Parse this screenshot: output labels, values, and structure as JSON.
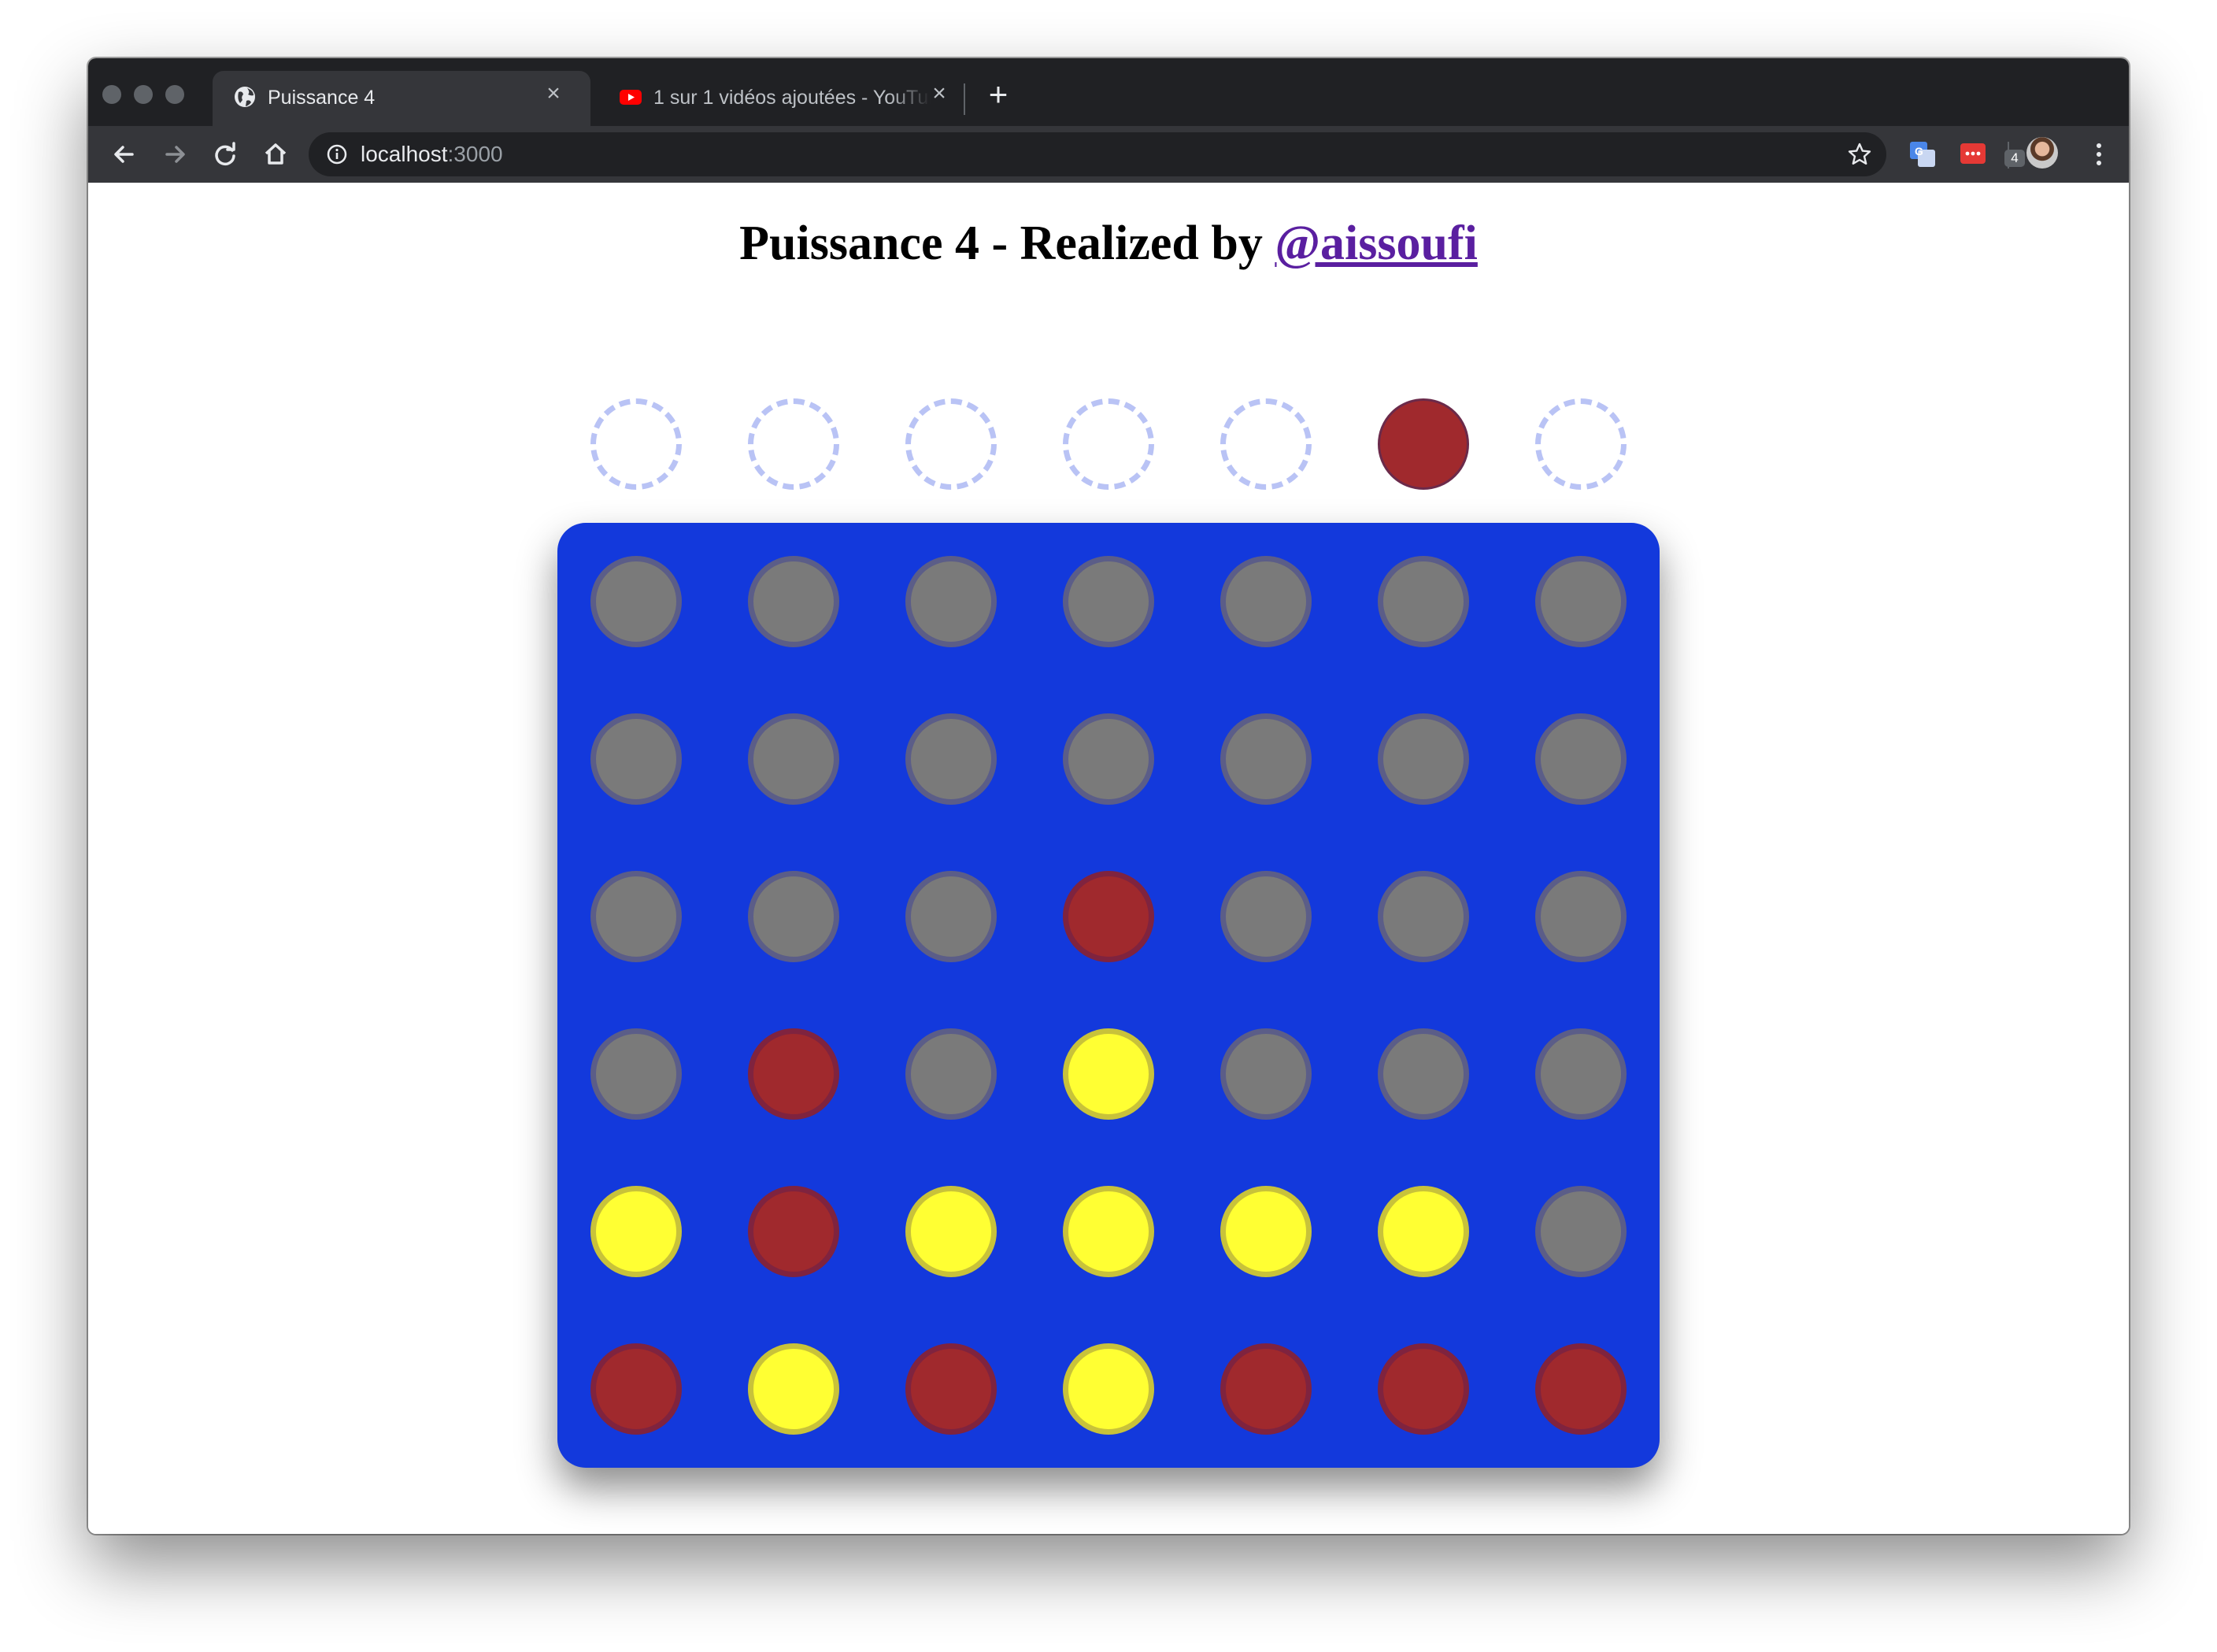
{
  "browser": {
    "tabs": [
      {
        "title": "Puissance 4",
        "active": true,
        "icon": "globe-icon"
      },
      {
        "title": "1 sur 1 vidéos ajoutées - YouTube",
        "active": false,
        "icon": "youtube-icon"
      }
    ],
    "address": {
      "host": "localhost",
      "port": ":3000"
    },
    "extensions_badge": "4"
  },
  "page": {
    "title_prefix": "Puissance 4 - Realized by ",
    "author_link": "@aissoufi"
  },
  "game": {
    "columns": 7,
    "rows": 6,
    "hover_column_index": 5,
    "current_player_color": "red",
    "colors": {
      "board": "#1339dc",
      "red": "#a0292d",
      "yellow": "#ffff33",
      "empty": "#7a7a7a",
      "selector_dashed": "#b9c3f5"
    },
    "grid": [
      [
        "empty",
        "empty",
        "empty",
        "empty",
        "empty",
        "empty",
        "empty"
      ],
      [
        "empty",
        "empty",
        "empty",
        "empty",
        "empty",
        "empty",
        "empty"
      ],
      [
        "empty",
        "empty",
        "empty",
        "red",
        "empty",
        "empty",
        "empty"
      ],
      [
        "empty",
        "red",
        "empty",
        "yellow",
        "empty",
        "empty",
        "empty"
      ],
      [
        "yellow",
        "red",
        "yellow",
        "yellow",
        "yellow",
        "yellow",
        "empty"
      ],
      [
        "red",
        "yellow",
        "red",
        "yellow",
        "red",
        "red",
        "red"
      ]
    ]
  }
}
